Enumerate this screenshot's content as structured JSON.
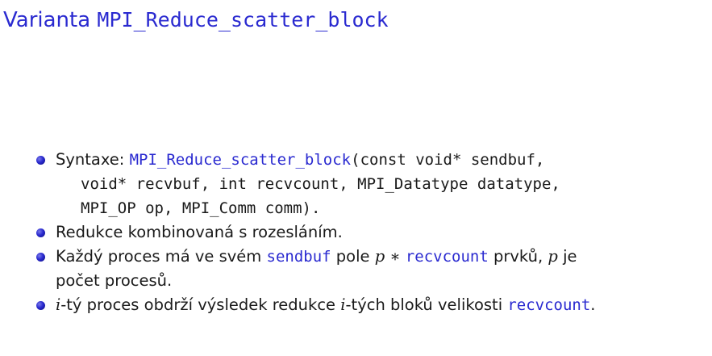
{
  "title": {
    "prefix": "Varianta ",
    "function": "MPI_Reduce_scatter_block"
  },
  "items": [
    {
      "label": "Syntaxe: ",
      "function": "MPI_Reduce_scatter_block",
      "signature_line1": "(const void* sendbuf,",
      "signature_line2": "void* recvbuf, int recvcount, MPI_Datatype datatype,",
      "signature_line3": "MPI_OP op, MPI_Comm comm)."
    },
    {
      "text": "Redukce kombinovaná s rozesláním."
    },
    {
      "part1": "Každý proces má ve svém ",
      "code1": "sendbuf",
      "part2": " pole ",
      "math_p": "p",
      "math_op": " ∗ ",
      "code2": "recvcount",
      "part3": " prvků, ",
      "math_p2": "p",
      "part4": " je",
      "line2": "počet procesů."
    },
    {
      "math_i": "i",
      "part1": "-tý proces obdrží výsledek redukce ",
      "math_i2": "i",
      "part2": "-tých bloků velikosti ",
      "code": "recvcount",
      "part3": "."
    }
  ]
}
